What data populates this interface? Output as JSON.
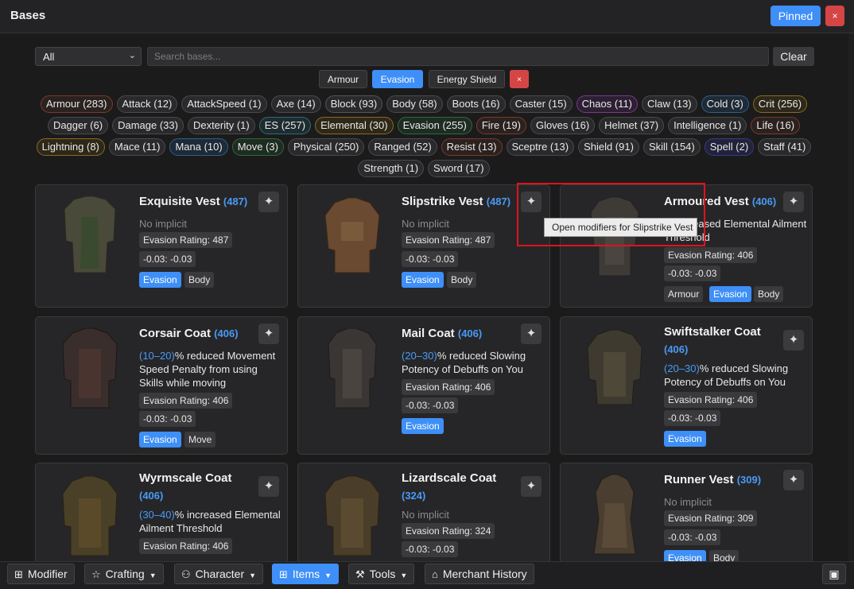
{
  "window": {
    "title": "Bases",
    "pinned_label": "Pinned",
    "close_label": "×"
  },
  "filters": {
    "select_value": "All",
    "search_placeholder": "Search bases...",
    "clear_label": "Clear",
    "segments": [
      "Armour",
      "Evasion",
      "Energy Shield"
    ],
    "active_segment": "Evasion",
    "segment_clear": "×"
  },
  "tags": [
    [
      "Armour (283)",
      "Attack (12)",
      "AttackSpeed (1)",
      "Axe (14)",
      "Block (93)",
      "Body (58)",
      "Boots (16)",
      "Caster (15)",
      "Chaos (11)",
      "Claw (13)",
      "Cold (3)",
      "Crit (256)"
    ],
    [
      "Dagger (6)",
      "Damage (33)",
      "Dexterity (1)",
      "ES (257)",
      "Elemental (30)",
      "Evasion (255)",
      "Fire (19)",
      "Gloves (16)",
      "Helmet (37)",
      "Intelligence (1)",
      "Life (16)"
    ],
    [
      "Lightning (8)",
      "Mace (11)",
      "Mana (10)",
      "Move (3)",
      "Physical (250)",
      "Ranged (52)",
      "Resist (13)",
      "Sceptre (13)",
      "Shield (91)",
      "Skill (154)",
      "Spell (2)",
      "Staff (41)"
    ],
    [
      "Strength (1)",
      "Sword (17)"
    ]
  ],
  "tag_colors": {
    "Armour (283)": "red",
    "Block (93)": "gray",
    "Chaos (11)": "purple",
    "Cold (3)": "blue",
    "Crit (256)": "gold",
    "ES (257)": "teal",
    "Elemental (30)": "gold",
    "Evasion (255)": "green",
    "Fire (19)": "red",
    "Life (16)": "red",
    "Lightning (8)": "gold",
    "Mana (10)": "blue",
    "Move (3)": "green",
    "Resist (13)": "red",
    "Spell (2)": "navy"
  },
  "cards": [
    {
      "name": "Exquisite Vest",
      "level": "(487)",
      "implicit_num": "",
      "implicit_text": "No implicit",
      "rating": "Evasion Rating: 487",
      "range": "-0.03: -0.03",
      "tags": [
        "Evasion",
        "Body"
      ]
    },
    {
      "name": "Slipstrike Vest",
      "level": "(487)",
      "implicit_num": "",
      "implicit_text": "No implicit",
      "rating": "Evasion Rating: 487",
      "range": "-0.03: -0.03",
      "tags": [
        "Evasion",
        "Body"
      ]
    },
    {
      "name": "Armoured Vest",
      "level": "(406)",
      "implicit_num": "",
      "implicit_text": "% increased Elemental Ailment Threshold",
      "rating": "Evasion Rating: 406",
      "range": "-0.03: -0.03",
      "tags": [
        "Armour",
        "Evasion",
        "Body"
      ]
    },
    {
      "name": "Corsair Coat",
      "level": "(406)",
      "implicit_num": "(10–20)",
      "implicit_text": "% reduced Movement Speed Penalty from using Skills while moving",
      "rating": "Evasion Rating: 406",
      "range": "-0.03: -0.03",
      "tags": [
        "Evasion",
        "Move"
      ]
    },
    {
      "name": "Mail Coat",
      "level": "(406)",
      "implicit_num": "(20–30)",
      "implicit_text": "% reduced Slowing Potency of Debuffs on You",
      "rating": "Evasion Rating: 406",
      "range": "-0.03: -0.03",
      "tags": [
        "Evasion"
      ]
    },
    {
      "name": "Swiftstalker Coat",
      "level": "(406)",
      "implicit_num": "(20–30)",
      "implicit_text": "% reduced Slowing Potency of Debuffs on You",
      "rating": "Evasion Rating: 406",
      "range": "-0.03: -0.03",
      "tags": [
        "Evasion"
      ]
    },
    {
      "name": "Wyrmscale Coat",
      "level": "(406)",
      "implicit_num": "(30–40)",
      "implicit_text": "% increased Elemental Ailment Threshold",
      "rating": "Evasion Rating: 406",
      "range": "",
      "tags": []
    },
    {
      "name": "Lizardscale Coat",
      "level": "(324)",
      "implicit_num": "",
      "implicit_text": "No implicit",
      "rating": "Evasion Rating: 324",
      "range": "-0.03: -0.03",
      "tags": []
    },
    {
      "name": "Runner Vest",
      "level": "(309)",
      "implicit_num": "",
      "implicit_text": "No implicit",
      "rating": "Evasion Rating: 309",
      "range": "-0.03: -0.03",
      "tags": [
        "Evasion",
        "Body"
      ]
    }
  ],
  "star_glyph": "✦",
  "tooltip": "Open modifiers for Slipstrike Vest",
  "bottom_bar": {
    "modifier": "Modifier",
    "crafting": "Crafting",
    "character": "Character",
    "items": "Items",
    "tools": "Tools",
    "merchant": "Merchant History"
  },
  "colors": {
    "accent": "#3e8ff7",
    "danger": "#d64545",
    "level": "#4a9af5",
    "highlight_box": "#e0131b"
  }
}
